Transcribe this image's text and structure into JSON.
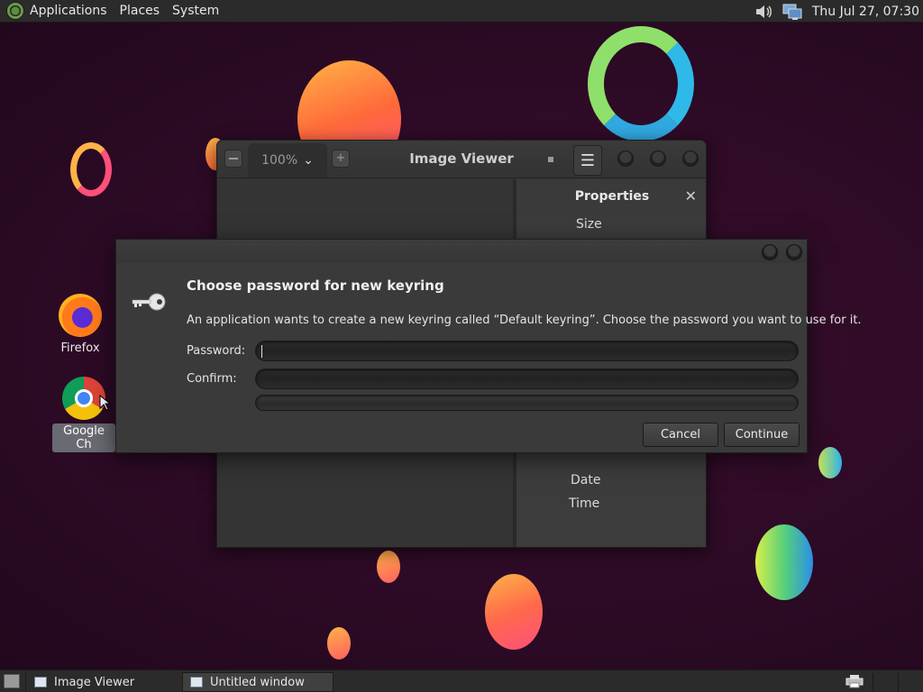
{
  "top_panel": {
    "menus": [
      "Applications",
      "Places",
      "System"
    ],
    "clock": "Thu Jul 27, 07:30",
    "tray_icons": [
      "volume-icon",
      "network-icon"
    ]
  },
  "desktop": {
    "icons": [
      {
        "name": "firefox",
        "label": "Firefox"
      },
      {
        "name": "google-chrome",
        "label": "Google Ch"
      }
    ]
  },
  "image_viewer": {
    "title": "Image Viewer",
    "zoom": "100%",
    "properties_title": "Properties",
    "properties": [
      "Size",
      "Date",
      "Time"
    ]
  },
  "dialog": {
    "heading": "Choose password for new keyring",
    "message": "An application wants to create a new keyring called “Default keyring”. Choose the password you want to use for it.",
    "password_label": "Password:",
    "confirm_label": "Confirm:",
    "password_value": "",
    "confirm_value": "",
    "cancel_label": "Cancel",
    "continue_label": "Continue"
  },
  "taskbar": {
    "items": [
      {
        "label": "Image Viewer",
        "active": false
      },
      {
        "label": "Untitled window",
        "active": true
      }
    ]
  }
}
